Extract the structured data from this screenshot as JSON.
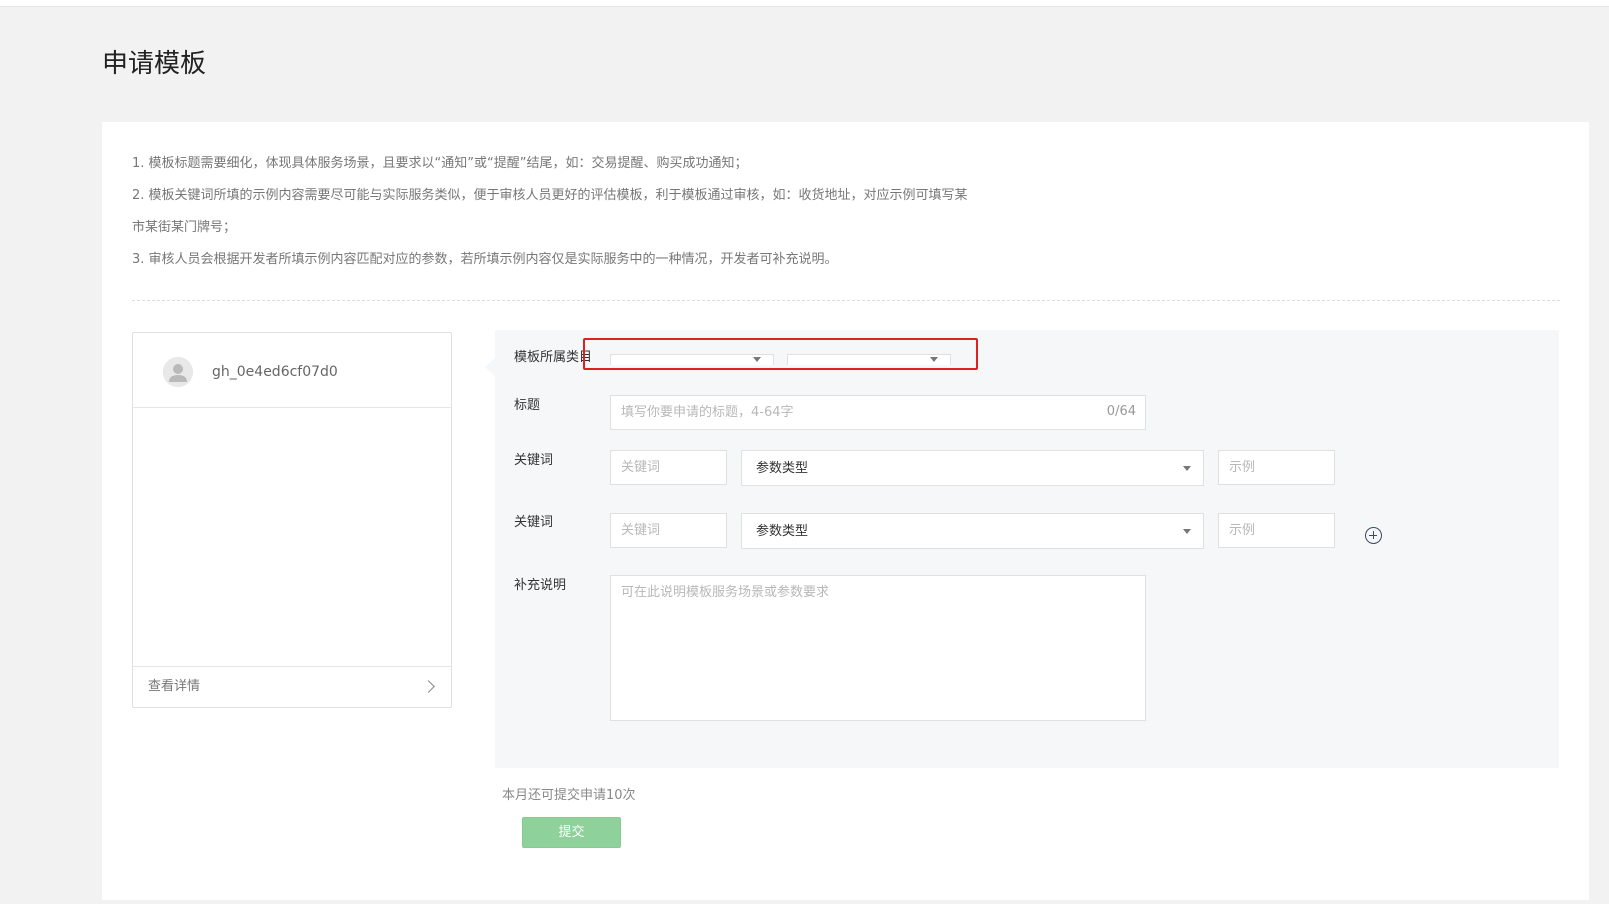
{
  "page": {
    "title": "申请模板"
  },
  "notes": [
    "1. 模板标题需要细化，体现具体服务场景，且要求以“通知”或“提醒”结尾，如：交易提醒、购买成功通知；",
    "2. 模板关键词所填的示例内容需要尽可能与实际服务类似，便于审核人员更好的评估模板，利于模板通过审核，如：收货地址，对应示例可填写某",
    "市某街某门牌号；",
    "3. 审核人员会根据开发者所填示例内容匹配对应的参数，若所填示例内容仅是实际服务中的一种情况，开发者可补充说明。"
  ],
  "preview": {
    "account_name": "gh_0e4ed6cf07d0",
    "detail_link": "查看详情"
  },
  "form": {
    "category_label": "模板所属类目",
    "title_label": "标题",
    "title_placeholder": "填写你要申请的标题，4-64字",
    "title_counter": "0/64",
    "keyword_rows": [
      {
        "label": "关键词",
        "keyword_placeholder": "关键词",
        "type_label": "参数类型",
        "example_placeholder": "示例"
      },
      {
        "label": "关键词",
        "keyword_placeholder": "关键词",
        "type_label": "参数类型",
        "example_placeholder": "示例"
      }
    ],
    "supplement_label": "补充说明",
    "supplement_placeholder": "可在此说明模板服务场景或参数要求"
  },
  "footer": {
    "remaining_text": "本月还可提交申请10次",
    "submit_label": "提交"
  },
  "colors": {
    "submit_bg": "#8fd19a",
    "highlight": "#e02020",
    "add_icon": "#3a4a66"
  }
}
